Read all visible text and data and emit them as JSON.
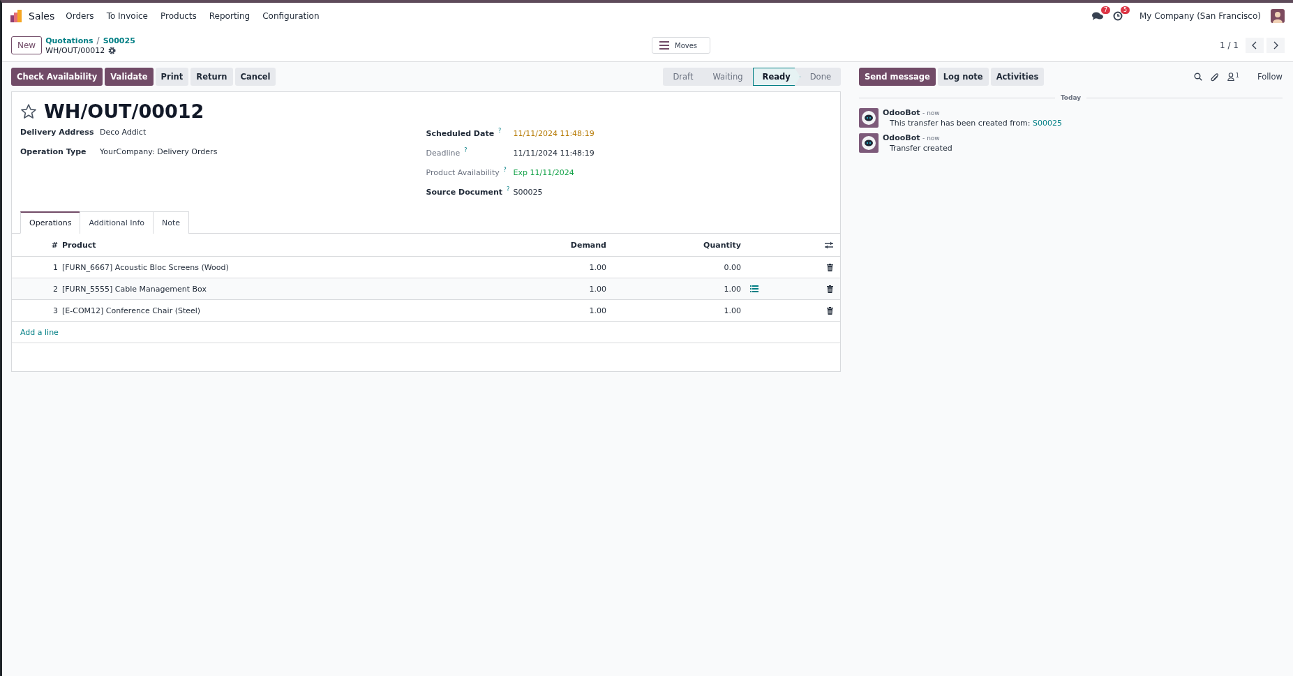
{
  "navbar": {
    "app_name": "Sales",
    "menu": [
      "Orders",
      "To Invoice",
      "Products",
      "Reporting",
      "Configuration"
    ],
    "messages_badge": "7",
    "activities_badge": "5",
    "company": "My Company (San Francisco)"
  },
  "control_panel": {
    "new_button": "New",
    "breadcrumb": [
      "Quotations",
      "S00025"
    ],
    "breadcrumb_separator": "/",
    "current": "WH/OUT/00012",
    "moves_button": "Moves",
    "pager": "1 / 1"
  },
  "actions": [
    {
      "label": "Check Availability",
      "primary": true
    },
    {
      "label": "Validate",
      "primary": true
    },
    {
      "label": "Print",
      "primary": false
    },
    {
      "label": "Return",
      "primary": false
    },
    {
      "label": "Cancel",
      "primary": false
    }
  ],
  "status_steps": [
    {
      "label": "Draft",
      "selected": false
    },
    {
      "label": "Waiting",
      "selected": false
    },
    {
      "label": "Ready",
      "selected": true
    },
    {
      "label": "Done",
      "selected": false
    }
  ],
  "record": {
    "starred": false,
    "name": "WH/OUT/00012",
    "left_fields": [
      {
        "label": "Delivery Address",
        "value": "Deco Addict",
        "required": true
      },
      {
        "label": "Operation Type",
        "value": "YourCompany: Delivery Orders",
        "required": true
      }
    ],
    "right_fields": [
      {
        "label": "Scheduled Date",
        "help": "?",
        "value": "11/11/2024 11:48:19",
        "required": true,
        "kind": "warning"
      },
      {
        "label": "Deadline",
        "help": "?",
        "value": "11/11/2024 11:48:19",
        "required": false,
        "kind": "normal"
      },
      {
        "label": "Product Availability",
        "help": "?",
        "value": "Exp 11/11/2024",
        "required": false,
        "kind": "success"
      },
      {
        "label": "Source Document",
        "help": "?",
        "value": "S00025",
        "required": true,
        "kind": "normal"
      }
    ],
    "tabs": [
      {
        "label": "Operations",
        "selected": true
      },
      {
        "label": "Additional Info",
        "selected": false
      },
      {
        "label": "Note",
        "selected": false
      }
    ],
    "table": {
      "columns": [
        "#",
        "Product",
        "Demand",
        "Quantity"
      ],
      "rows": [
        {
          "index": "1",
          "product": "[FURN_6667] Acoustic Bloc Screens (Wood)",
          "demand": "1.00",
          "quantity": "0.00",
          "details": false
        },
        {
          "index": "2",
          "product": "[FURN_5555] Cable Management Box",
          "demand": "1.00",
          "quantity": "1.00",
          "details": true
        },
        {
          "index": "3",
          "product": "[E-COM12] Conference Chair (Steel)",
          "demand": "1.00",
          "quantity": "1.00",
          "details": false
        }
      ],
      "add_line": "Add a line"
    }
  },
  "chatter": {
    "buttons": [
      {
        "label": "Send message",
        "primary": true
      },
      {
        "label": "Log note",
        "primary": false
      },
      {
        "label": "Activities",
        "primary": false
      }
    ],
    "followers_count": "1",
    "follow": "Follow",
    "separator": "Today",
    "messages": [
      {
        "author": "OdooBot",
        "time": "- now",
        "text": "This transfer has been created from: ",
        "link": "S00025"
      },
      {
        "author": "OdooBot",
        "time": "- now",
        "text": "Transfer created"
      }
    ]
  }
}
